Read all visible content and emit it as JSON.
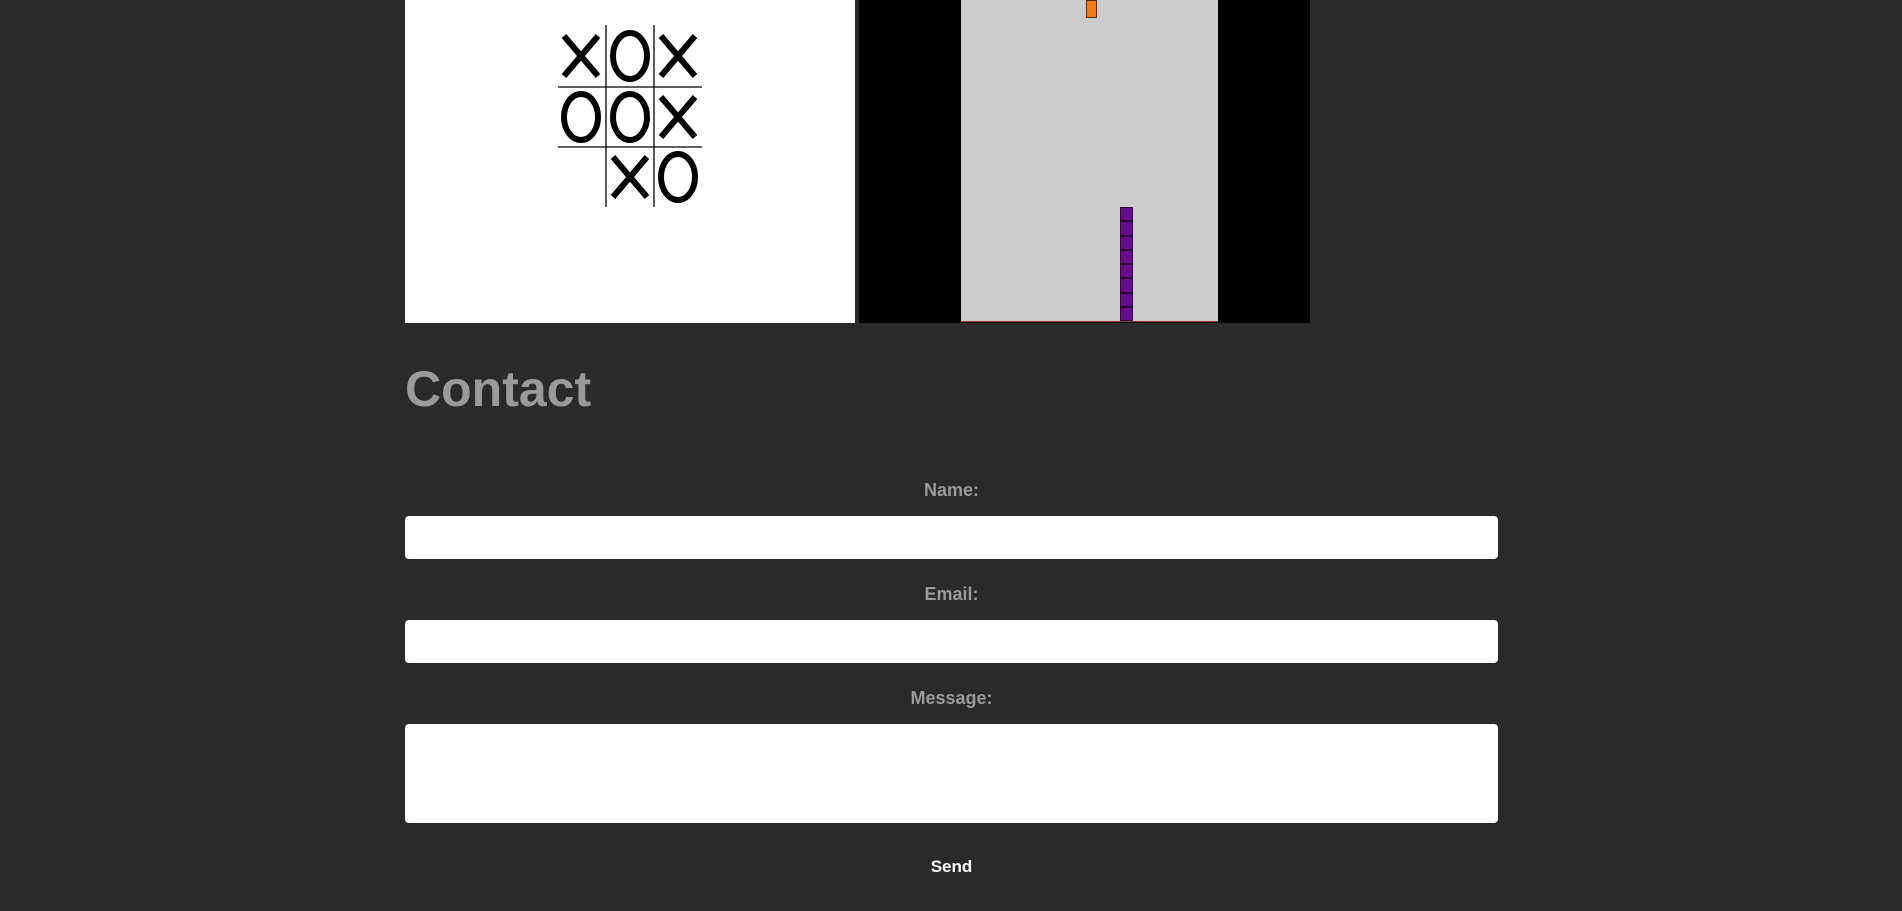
{
  "projects": {
    "tictactoe": {
      "board": [
        [
          "X",
          "O",
          "X"
        ],
        [
          "O",
          "O",
          "X"
        ],
        [
          "",
          "X",
          "O"
        ]
      ]
    },
    "tetris": {
      "falling_piece_color": "#f07c12",
      "stack_color": "#6a0a8c",
      "well_color": "#cccccc"
    }
  },
  "contact": {
    "title": "Contact",
    "name_label": "Name:",
    "name_value": "",
    "email_label": "Email:",
    "email_value": "",
    "message_label": "Message:",
    "message_value": "",
    "send_label": "Send"
  }
}
